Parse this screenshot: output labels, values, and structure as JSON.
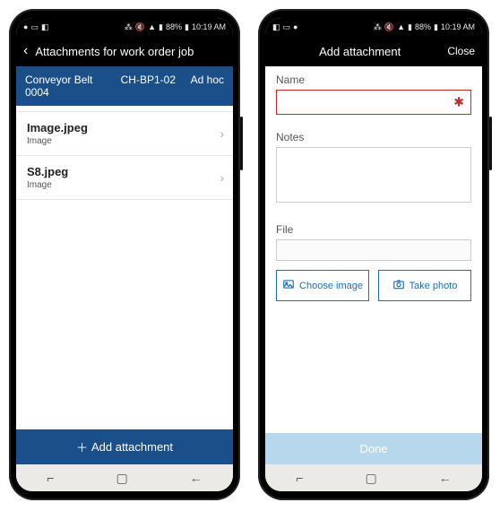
{
  "status": {
    "battery": "88%",
    "time": "10:19 AM"
  },
  "left": {
    "header_title": "Attachments for work order job",
    "context": {
      "asset": "Conveyor Belt 0004",
      "id": "CH-BP1-02",
      "type": "Ad hoc"
    },
    "attachments": [
      {
        "name": "Image.jpeg",
        "type": "Image"
      },
      {
        "name": "S8.jpeg",
        "type": "Image"
      }
    ],
    "footer": "Add attachment"
  },
  "right": {
    "header_title": "Add attachment",
    "close": "Close",
    "labels": {
      "name": "Name",
      "notes": "Notes",
      "file": "File"
    },
    "buttons": {
      "choose_image": "Choose image",
      "take_photo": "Take photo",
      "done": "Done"
    },
    "values": {
      "name": "",
      "notes": ""
    }
  },
  "nav": {
    "recent": "⌐",
    "home": "▢",
    "back_soft": "←"
  }
}
